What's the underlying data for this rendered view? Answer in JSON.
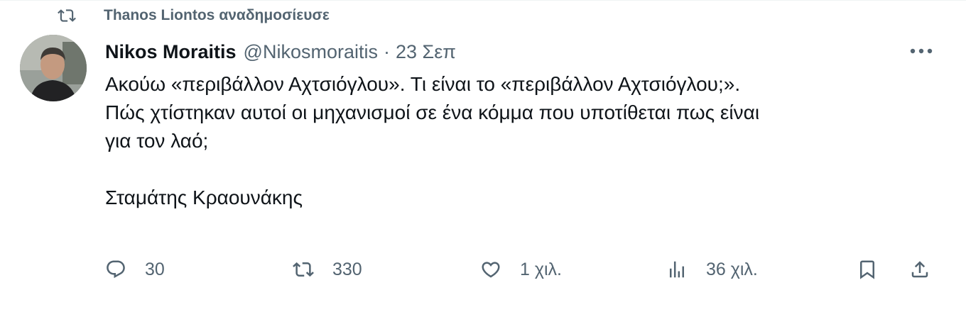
{
  "repost_banner": {
    "icon": "repost-icon",
    "user": "Thanos Liontos",
    "verb": "αναδημοσίευσε"
  },
  "author": {
    "display_name": "Nikos Moraitis",
    "handle": "@Nikosmoraitis",
    "separator": "·",
    "time": "23 Σεπ"
  },
  "body": {
    "line1": "Ακούω «περιβάλλον Αχτσιόγλου». Τι είναι το «περιβάλλον Αχτσιόγλου;».",
    "line2": "Πώς χτίστηκαν αυτοί οι μηχανισμοί σε ένα κόμμα που υποτίθεται πως είναι",
    "line3": "για τον λαό;",
    "signature": "Σταμάτης Κραουνάκης"
  },
  "actions": {
    "replies": "30",
    "reposts": "330",
    "likes": "1 χιλ.",
    "views": "36 χιλ."
  },
  "colors": {
    "text": "#0f1419",
    "secondary": "#536471",
    "background": "#ffffff"
  }
}
